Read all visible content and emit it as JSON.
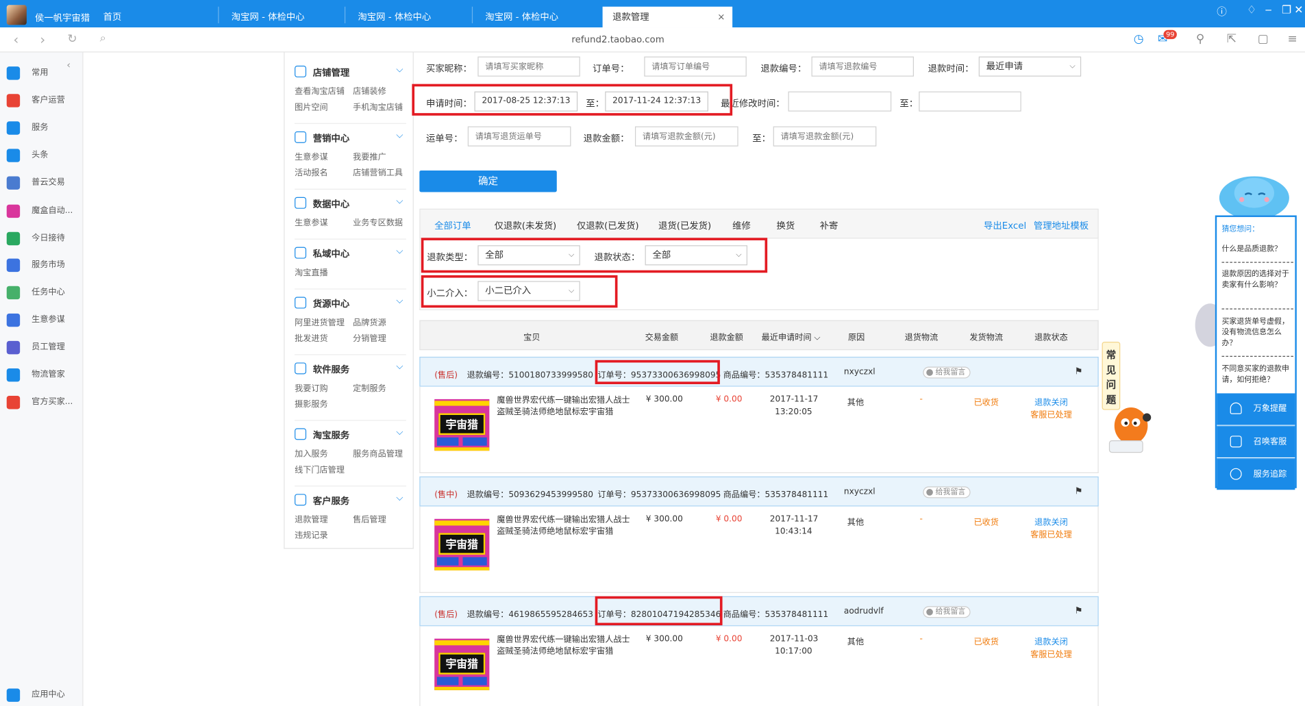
{
  "browser": {
    "user_name": "侯一帆宇宙猎",
    "tabs": [
      {
        "label": "首页"
      },
      {
        "label": "淘宝网 - 体检中心"
      },
      {
        "label": "淘宝网 - 体检中心"
      },
      {
        "label": "淘宝网 - 体检中心"
      },
      {
        "label": "退款管理"
      }
    ],
    "close_glyph": "×",
    "url": "refund2.taobao.com",
    "mail_badge": "99"
  },
  "left_apps": [
    {
      "label": "常用",
      "color": "#1a8be8"
    },
    {
      "label": "客户运营",
      "color": "#e84335"
    },
    {
      "label": "服务",
      "color": "#1a8be8"
    },
    {
      "label": "头条",
      "color": "#1a8be8"
    },
    {
      "label": "普云交易",
      "color": "#4a7bd0"
    },
    {
      "label": "魔盒自动...",
      "color": "#d9369c"
    },
    {
      "label": "今日接待",
      "color": "#2aa860"
    },
    {
      "label": "服务市场",
      "color": "#3c73e0"
    },
    {
      "label": "任务中心",
      "color": "#46b06a"
    },
    {
      "label": "生意参谋",
      "color": "#3c73e0"
    },
    {
      "label": "员工管理",
      "color": "#5a5fd0"
    },
    {
      "label": "物流管家",
      "color": "#1a8be8"
    },
    {
      "label": "官方买家...",
      "color": "#e84335"
    },
    {
      "label": "应用中心",
      "color": "#1a8be8"
    }
  ],
  "nav_groups": [
    {
      "title": "店铺管理",
      "links": [
        "查看淘宝店铺",
        "店铺装修",
        "图片空间",
        "手机淘宝店铺"
      ]
    },
    {
      "title": "营销中心",
      "links": [
        "生意参谋",
        "我要推广",
        "活动报名",
        "店铺营销工具"
      ]
    },
    {
      "title": "数据中心",
      "links": [
        "生意参谋",
        "业务专区数据"
      ]
    },
    {
      "title": "私域中心",
      "links": [
        "淘宝直播"
      ]
    },
    {
      "title": "货源中心",
      "links": [
        "阿里进货管理",
        "品牌货源",
        "批发进货",
        "分销管理"
      ]
    },
    {
      "title": "软件服务",
      "links": [
        "我要订购",
        "定制服务",
        "摄影服务"
      ]
    },
    {
      "title": "淘宝服务",
      "links": [
        "加入服务",
        "服务商品管理",
        "线下门店管理"
      ]
    },
    {
      "title": "客户服务",
      "links": [
        "退款管理",
        "售后管理",
        "违规记录"
      ]
    }
  ],
  "filters": {
    "buyer_nick_label": "买家昵称：",
    "buyer_nick_placeholder": "请填写买家昵称",
    "order_no_label": "订单号：",
    "order_no_placeholder": "请填写订单编号",
    "refund_no_label": "退款编号：",
    "refund_no_placeholder": "请填写退款编号",
    "refund_time_label": "退款时间：",
    "refund_time_value": "最近申请",
    "apply_time_label": "申请时间：",
    "apply_time_from": "2017-08-25 12:37:13",
    "to_label": "至：",
    "apply_time_to": "2017-11-24 12:37:13",
    "modify_time_label": "最近修改时间：",
    "waybill_label": "运单号：",
    "waybill_placeholder": "请填写退货运单号",
    "amount_label": "退款金额：",
    "amount_placeholder": "请填写退款金额(元)",
    "confirm_label": "确定"
  },
  "order_tabs": [
    "全部订单",
    "仅退款(未发货)",
    "仅退款(已发货)",
    "退货(已发货)",
    "维修",
    "换货",
    "补寄"
  ],
  "export_excel": "导出Excel",
  "address_template": "管理地址模板",
  "sub_filters": {
    "refund_type_label": "退款类型：",
    "refund_type_value": "全部",
    "refund_status_label": "退款状态：",
    "refund_status_value": "全部",
    "xiaoer_label": "小二介入：",
    "xiaoer_value": "小二已介入"
  },
  "table_headers": [
    "宝贝",
    "交易金额",
    "退款金额",
    "最近申请时间",
    "原因",
    "退货物流",
    "发货物流",
    "退款状态"
  ],
  "orders": [
    {
      "phase": "(售后)",
      "refund_no": "退款编号：5100180733999580",
      "order_no": "订单号：95373300636998095",
      "item_no": "商品编号：535378481111",
      "buyer": "nxyczxl",
      "msg": "给我留言",
      "product": "魔兽世界宏代练一键输出宏猎人战士盗贼圣骑法师绝地鼠标宏宇宙猎",
      "img_text": "宇宙猎",
      "trade_amount": "¥ 300.00",
      "refund_amount": "¥ 0.00",
      "date": "2017-11-17",
      "time": "13:20:05",
      "reason": "其他",
      "return_logistics": "-",
      "ship_logistics": "已收货",
      "status1": "退款关闭",
      "status2": "客服已处理"
    },
    {
      "phase": "(售中)",
      "refund_no": "退款编号：5093629453999580",
      "order_no": "订单号：95373300636998095",
      "item_no": "商品编号：535378481111",
      "buyer": "nxyczxl",
      "msg": "给我留言",
      "product": "魔兽世界宏代练一键输出宏猎人战士盗贼圣骑法师绝地鼠标宏宇宙猎",
      "img_text": "宇宙猎",
      "trade_amount": "¥ 300.00",
      "refund_amount": "¥ 0.00",
      "date": "2017-11-17",
      "time": "10:43:14",
      "reason": "其他",
      "return_logistics": "-",
      "ship_logistics": "已收货",
      "status1": "退款关闭",
      "status2": "客服已处理"
    },
    {
      "phase": "(售后)",
      "refund_no": "退款编号：4619865595284653",
      "order_no": "订单号：82801047194285346",
      "item_no": "商品编号：535378481111",
      "buyer": "aodrudvlf",
      "msg": "给我留言",
      "product": "魔兽世界宏代练一键输出宏猎人战士盗贼圣骑法师绝地鼠标宏宇宙猎",
      "img_text": "宇宙猎",
      "trade_amount": "¥ 300.00",
      "refund_amount": "¥ 0.00",
      "date": "2017-11-03",
      "time": "10:17:00",
      "reason": "其他",
      "return_logistics": "-",
      "ship_logistics": "已收货",
      "status1": "退款关闭",
      "status2": "客服已处理"
    }
  ],
  "faq_side": "常见问题",
  "assistant": {
    "title": "猜您想问：",
    "questions": [
      "什么是品质退款？",
      "退款原因的选择对于卖家有什么影响？",
      "买家退货单号虚假，没有物流信息怎么办？",
      "不同意买家的退款申请，如何拒绝？"
    ],
    "buttons": [
      "万象提醒",
      "召唤客服",
      "服务追踪"
    ]
  },
  "colors": {
    "brand": "#1a8be8",
    "highlight": "#e31b23",
    "price": "#e84335",
    "received": "#f07a0a"
  }
}
